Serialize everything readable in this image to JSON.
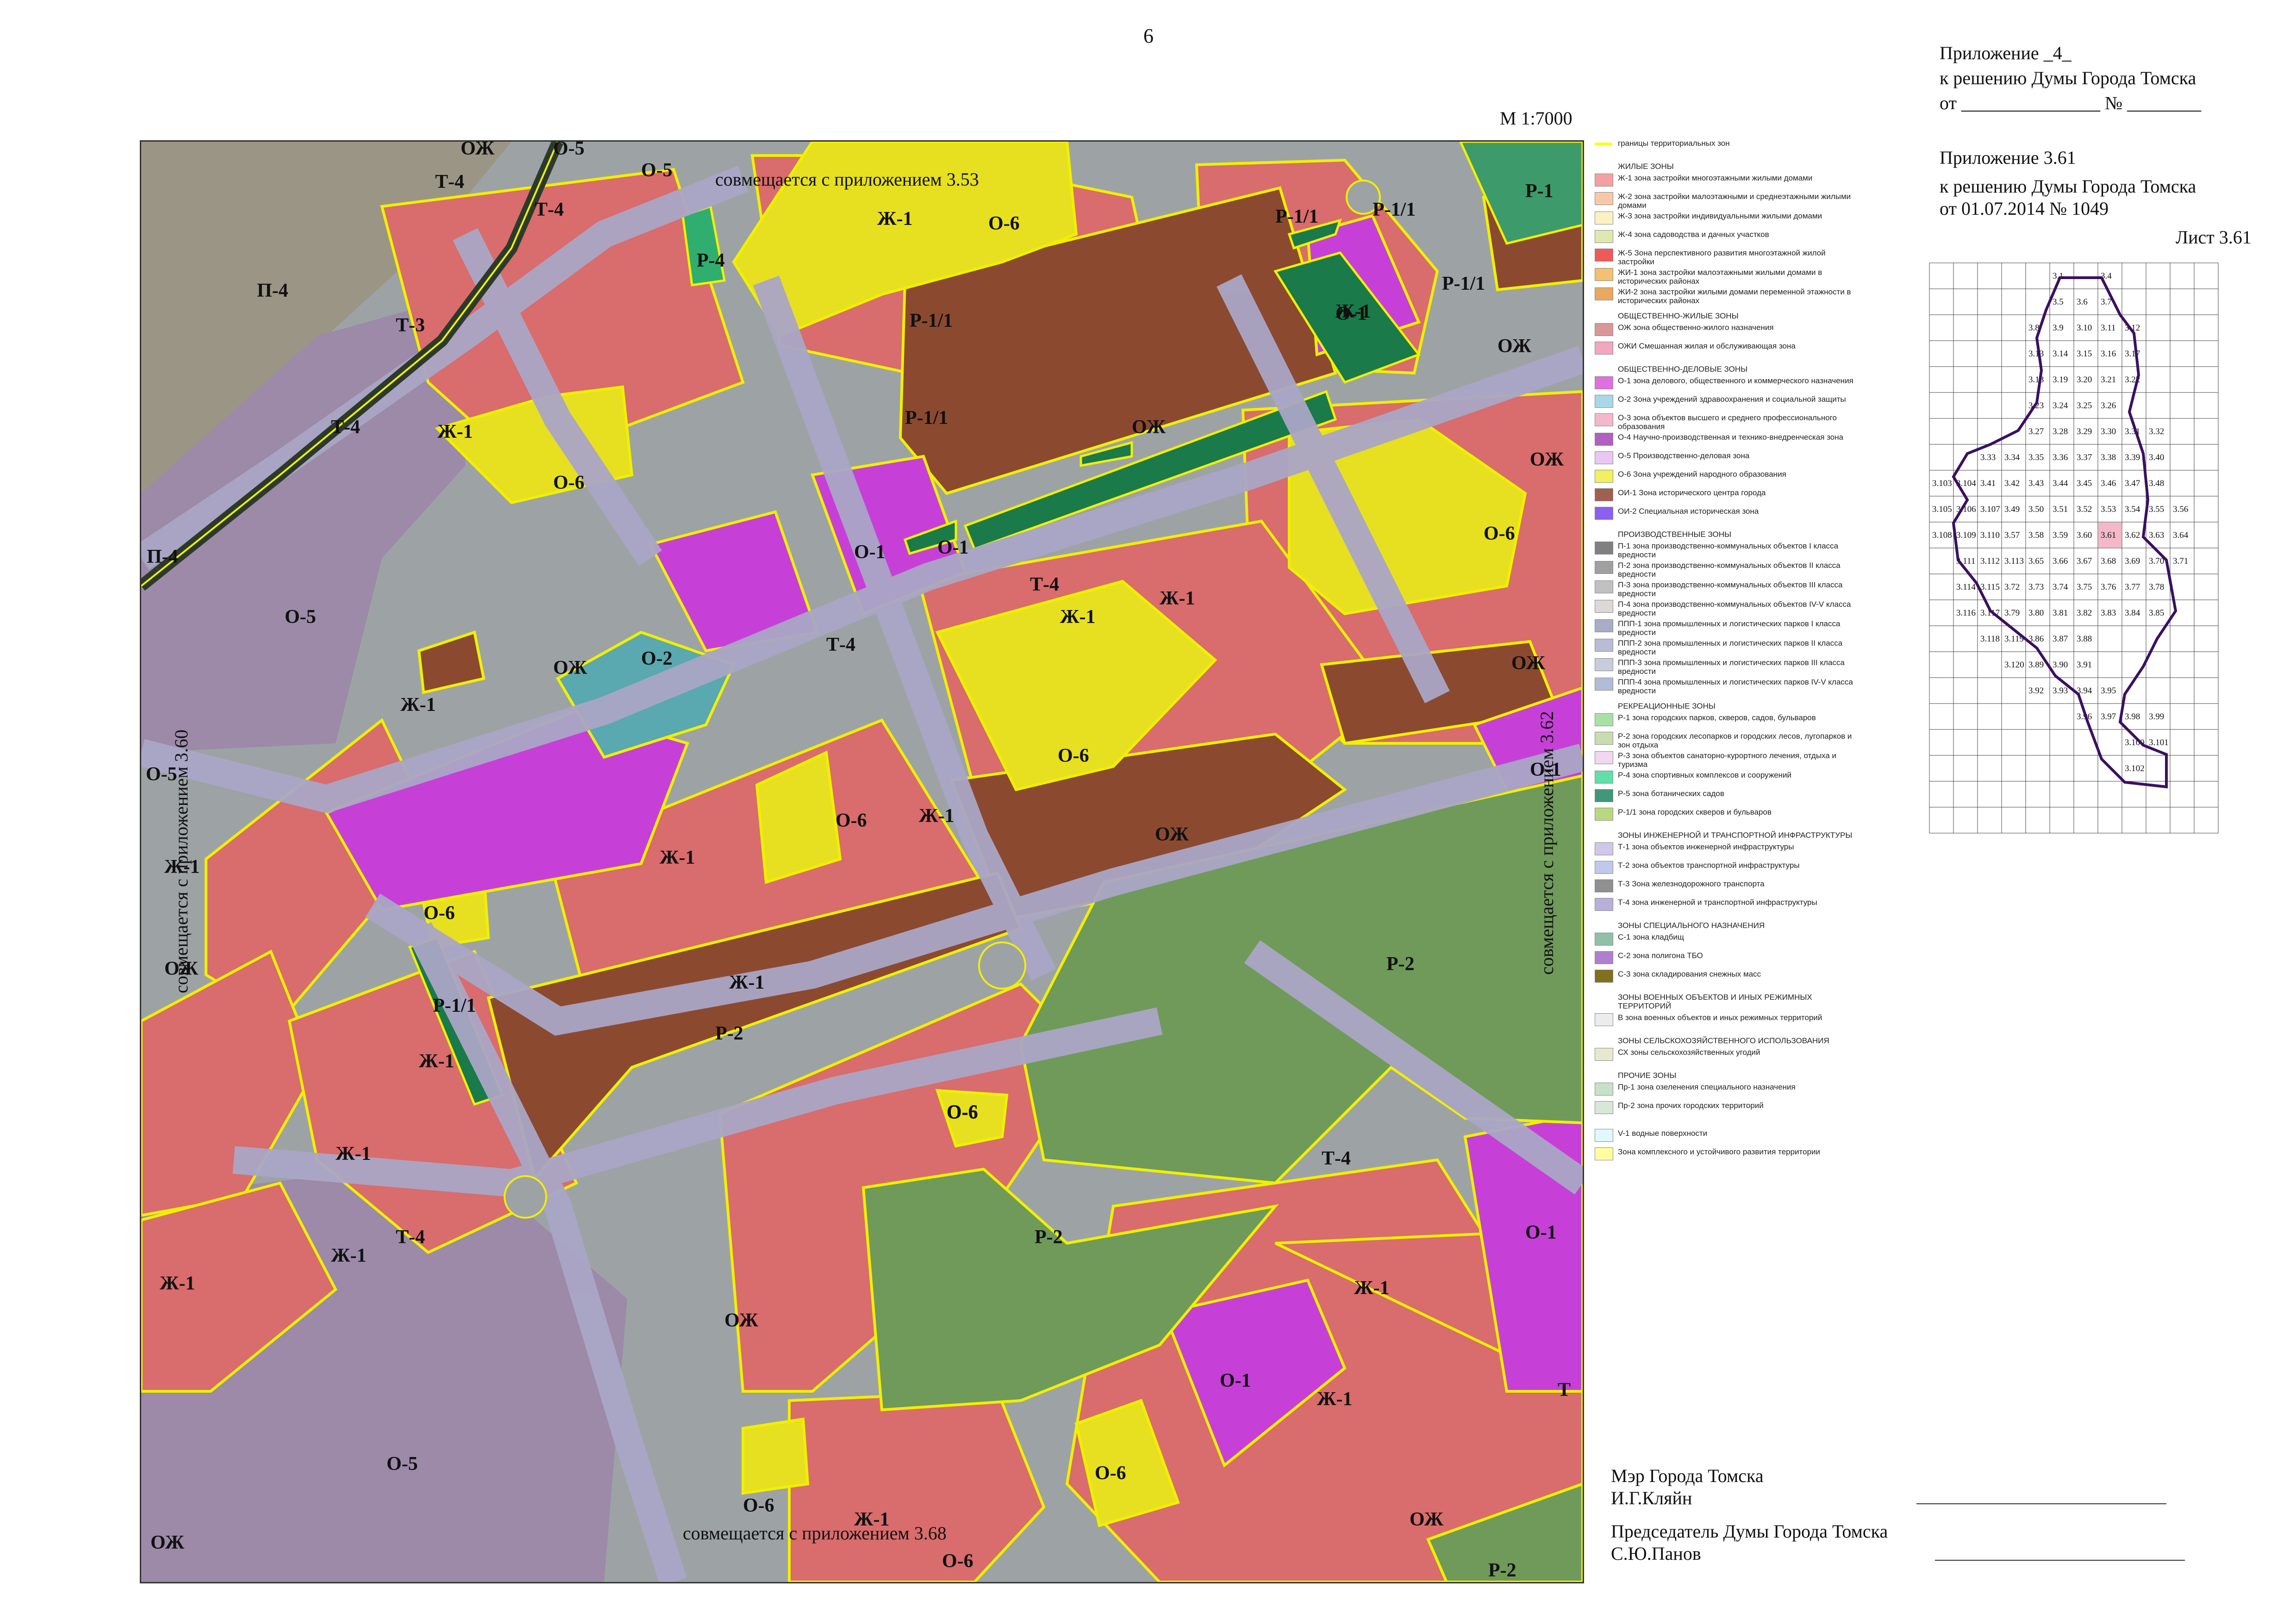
{
  "page_number": "6",
  "header": {
    "line1": "Приложение _4_",
    "line2": "к решению Думы Города Томска",
    "line3": "от _______________ № ________",
    "line4": "Приложение 3.61",
    "line5": "к решению Думы Города Томска",
    "line6": "от  01.07.2014  № 1049",
    "sheet": "Лист 3.61"
  },
  "scale": "М 1:7000",
  "edge_labels": {
    "top": "совмещается с приложением 3.53",
    "bottom": "совмещается с приложением 3.68",
    "left": "совмещается с приложением 3.60",
    "right": "совмещается с приложением 3.62"
  },
  "zone_labels": [
    "ОЖ",
    "О-5",
    "О-5",
    "Т-4",
    "Т-4",
    "Р-4",
    "Ж-1",
    "О-6",
    "Р-1/1",
    "Р-1/1",
    "Р-1",
    "П-4",
    "Т-3",
    "Ж-1",
    "Р-1/1",
    "Р-1/1",
    "О-1",
    "ОЖ",
    "Т-4",
    "Ж-1",
    "О-6",
    "Р-1/1",
    "ОЖ",
    "ОЖ",
    "Т-4",
    "П-4",
    "О-5",
    "О-1",
    "О-1",
    "Ж-1",
    "О-6",
    "О-2",
    "Т-4",
    "ОЖ",
    "Ж-1",
    "Ж-1",
    "О-6",
    "ОЖ",
    "ОЖ",
    "О-5",
    "О-6",
    "Ж-1",
    "О-6",
    "Ж-1",
    "Ж-1",
    "ОЖ",
    "Р-2",
    "О-1",
    "Ж-1",
    "О-6",
    "Р-1/1",
    "Ж-1",
    "ОЖ",
    "Ж-1",
    "Ж-1",
    "О-6",
    "Т-4",
    "Р-2",
    "О-1",
    "Ж-1",
    "Т-4",
    "Ж-1",
    "О-1",
    "Ж-1",
    "О-5",
    "О-6",
    "О-6",
    "Ж-1",
    "ОЖ",
    "ОЖ",
    "О-6",
    "Р-2",
    "Р-2",
    "Т"
  ],
  "legend": {
    "boundary": "границы территориальных зон",
    "sections": [
      {
        "title": "ЖИЛЫЕ ЗОНЫ",
        "items": [
          {
            "code": "Ж-1",
            "text": "Ж-1 зона застройки многоэтажными жилыми домами",
            "color": "#f4a0a0"
          },
          {
            "code": "Ж-2",
            "text": "Ж-2 зона застройки малоэтажными и среднеэтажными жилыми домами",
            "color": "#f7c8a8"
          },
          {
            "code": "Ж-3",
            "text": "Ж-3 зона застройки индивидуальными жилыми домами",
            "color": "#fbf2c4"
          },
          {
            "code": "Ж-4",
            "text": "Ж-4 зона садоводства и дачных участков",
            "color": "#dfe8b0"
          },
          {
            "code": "Ж-5",
            "text": "Ж-5 Зона перспективного развития многоэтажной жилой застройки",
            "color": "#ee5a5a"
          },
          {
            "code": "ЖИ-1",
            "text": "ЖИ-1 зона застройки малоэтажными жилыми домами в исторических районах",
            "color": "#f2c070"
          },
          {
            "code": "ЖИ-2",
            "text": "ЖИ-2 зона застройки жилыми домами переменной этажности в исторических районах",
            "color": "#e9a860"
          }
        ]
      },
      {
        "title": "ОБЩЕСТВЕННО-ЖИЛЫЕ ЗОНЫ",
        "items": [
          {
            "code": "ОЖ",
            "text": "ОЖ зона общественно-жилого назначения",
            "color": "#d89898"
          },
          {
            "code": "ОЖИ",
            "text": "ОЖИ Смешанная жилая и обслуживающая зона",
            "color": "#f2a6c0"
          }
        ]
      },
      {
        "title": "ОБЩЕСТВЕННО-ДЕЛОВЫЕ ЗОНЫ",
        "items": [
          {
            "code": "О-1",
            "text": "О-1 зона делового, общественного и коммерческого назначения",
            "color": "#e070e0"
          },
          {
            "code": "О-2",
            "text": "О-2 Зона учреждений здравоохранения и социальной защиты",
            "color": "#a8d8e8"
          },
          {
            "code": "О-3",
            "text": "О-3 зона объектов высшего и среднего профессионального образования",
            "color": "#f4b8c8"
          },
          {
            "code": "О-4",
            "text": "О-4 Научно-производственная и технико-внедренческая зона",
            "color": "#b060c0"
          },
          {
            "code": "О-5",
            "text": "О-5 Производственно-деловая зона",
            "color": "#e8c8f0"
          },
          {
            "code": "О-6",
            "text": "О-6 Зона учреждений народного образования",
            "color": "#f0f060"
          },
          {
            "code": "ОИ-1",
            "text": "ОИ-1 Зона исторического центра города",
            "color": "#a06050"
          },
          {
            "code": "ОИ-2",
            "text": "ОИ-2 Специальная историческая зона",
            "color": "#8a60f0"
          }
        ]
      },
      {
        "title": "ПРОИЗВОДСТВЕННЫЕ ЗОНЫ",
        "items": [
          {
            "code": "П-1",
            "text": "П-1 зона производственно-коммунальных объектов I класса вредности",
            "color": "#808080"
          },
          {
            "code": "П-2",
            "text": "П-2 зона производственно-коммунальных объектов II класса вредности",
            "color": "#a0a0a0"
          },
          {
            "code": "П-3",
            "text": "П-3 зона производственно-коммунальных объектов III класса вредности",
            "color": "#c0c0c0"
          },
          {
            "code": "П-4",
            "text": "П-4 зона производственно-коммунальных объектов IV-V класса вредности",
            "color": "#dcd8d8"
          },
          {
            "code": "ППП-1",
            "text": "ППП-1 зона промышленных и логистических парков I класса вредности",
            "color": "#a8acc8"
          },
          {
            "code": "ППП-2",
            "text": "ППП-2 зона промышленных и логистических парков II класса вредности",
            "color": "#b8bcd4"
          },
          {
            "code": "ППП-3",
            "text": "ППП-3 зона промышленных и логистических парков III класса вредности",
            "color": "#c8ccdc"
          },
          {
            "code": "ППП-4",
            "text": "ППП-4 зона промышленных и логистических парков IV-V класса вредности",
            "color": "#b0bcd8"
          }
        ]
      },
      {
        "title": "РЕКРЕАЦИОННЫЕ ЗОНЫ",
        "items": [
          {
            "code": "Р-1",
            "text": "Р-1 зона городских парков, скверов, садов, бульваров",
            "color": "#a8e0a8"
          },
          {
            "code": "Р-2",
            "text": "Р-2 зона городских лесопарков и городских лесов, лугопарков и зон отдыха",
            "color": "#c8dcb0"
          },
          {
            "code": "Р-3",
            "text": "Р-3 зона объектов санаторно-курортного лечения, отдыха и туризма",
            "color": "#f0d8f0"
          },
          {
            "code": "Р-4",
            "text": "Р-4 зона спортивных комплексов и сооружений",
            "color": "#60e0a8"
          },
          {
            "code": "Р-5",
            "text": "Р-5 зона ботанических садов",
            "color": "#409878"
          },
          {
            "code": "Р-1/1",
            "text": "Р-1/1 зона городских скверов и бульваров",
            "color": "#b8d880"
          }
        ]
      },
      {
        "title": "ЗОНЫ ИНЖЕНЕРНОЙ И ТРАНСПОРТНОЙ ИНФРАСТРУКТУРЫ",
        "items": [
          {
            "code": "Т-1",
            "text": "Т-1 зона объектов инженерной инфраструктуры",
            "color": "#d0c8e8"
          },
          {
            "code": "Т-2",
            "text": "Т-2 зона объектов транспортной инфраструктуры",
            "color": "#c0c8ec"
          },
          {
            "code": "Т-3",
            "text": "Т-3 Зона железнодорожного транспорта",
            "color": "#909090"
          },
          {
            "code": "Т-4",
            "text": "Т-4 зона инженерной и транспортной инфраструктуры",
            "color": "#b8b0d8"
          }
        ]
      },
      {
        "title": "ЗОНЫ СПЕЦИАЛЬНОГО НАЗНАЧЕНИЯ",
        "items": [
          {
            "code": "С-1",
            "text": "С-1 зона кладбищ",
            "color": "#90c0a8"
          },
          {
            "code": "С-2",
            "text": "С-2 зона полигона ТБО",
            "color": "#b080d0"
          },
          {
            "code": "С-3",
            "text": "С-3 зона складирования снежных масс",
            "color": "#807020"
          }
        ]
      },
      {
        "title": "ЗОНЫ ВОЕННЫХ ОБЪЕКТОВ И ИНЫХ РЕЖИМНЫХ ТЕРРИТОРИЙ",
        "items": [
          {
            "code": "В",
            "text": "В зона военных объектов и иных режимных территорий",
            "color": "#ececec"
          }
        ]
      },
      {
        "title": "ЗОНЫ СЕЛЬСКОХОЗЯЙСТВЕННОГО ИСПОЛЬЗОВАНИЯ",
        "items": [
          {
            "code": "СХ",
            "text": "СХ зоны сельскохозяйственных угодий",
            "color": "#e8e8d0"
          }
        ]
      },
      {
        "title": "ПРОЧИЕ ЗОНЫ",
        "items": [
          {
            "code": "Пр-1",
            "text": "Пр-1 зона озеленения специального назначения",
            "color": "#c8e0c8"
          },
          {
            "code": "Пр-2",
            "text": "Пр-2 зона прочих городских территорий",
            "color": "#d8e8d8"
          }
        ]
      },
      {
        "title": "",
        "items": [
          {
            "code": "V-1",
            "text": "V-1 водные поверхности",
            "color": "#e0f8ff"
          },
          {
            "code": "КУРТ",
            "text": "Зона комплексного и устойчивого развития территории",
            "color": "#ffffa0"
          }
        ]
      }
    ]
  },
  "index_grid": {
    "highlight": "3.61",
    "cells": [
      "3.1",
      "3.4",
      "3.5",
      "3.6",
      "3.7",
      "3.8",
      "3.9",
      "3.10",
      "3.11",
      "3.12",
      "3.13",
      "3.14",
      "3.15",
      "3.16",
      "3.17",
      "3.18",
      "3.19",
      "3.20",
      "3.21",
      "3.22",
      "3.23",
      "3.24",
      "3.25",
      "3.26",
      "3.27",
      "3.28",
      "3.29",
      "3.30",
      "3.31",
      "3.32",
      "3.33",
      "3.34",
      "3.35",
      "3.36",
      "3.37",
      "3.38",
      "3.39",
      "3.40",
      "3.103",
      "3.104",
      "3.41",
      "3.42",
      "3.43",
      "3.44",
      "3.45",
      "3.46",
      "3.47",
      "3.48",
      "3.105",
      "3.106",
      "3.107",
      "3.49",
      "3.50",
      "3.51",
      "3.52",
      "3.53",
      "3.54",
      "3.55",
      "3.56",
      "3.108",
      "3.109",
      "3.110",
      "3.57",
      "3.58",
      "3.59",
      "3.60",
      "3.61",
      "3.62",
      "3.63",
      "3.64",
      "3.111",
      "3.112",
      "3.113",
      "3.65",
      "3.66",
      "3.67",
      "3.68",
      "3.69",
      "3.70",
      "3.71",
      "3.114",
      "3.115",
      "3.72",
      "3.73",
      "3.74",
      "3.75",
      "3.76",
      "3.77",
      "3.78",
      "3.116",
      "3.117",
      "3.79",
      "3.80",
      "3.81",
      "3.82",
      "3.83",
      "3.84",
      "3.85",
      "3.118",
      "3.119",
      "3.86",
      "3.87",
      "3.88",
      "3.120",
      "3.89",
      "3.90",
      "3.91",
      "3.92",
      "3.93",
      "3.94",
      "3.95",
      "3.96",
      "3.97",
      "3.98",
      "3.99",
      "3.100",
      "3.101",
      "3.102"
    ]
  },
  "signatures": {
    "mayor_title": "Мэр Города Томска",
    "mayor_name": "И.Г.Кляйн",
    "chair_title": "Председатель Думы Города Томска",
    "chair_name": "С.Ю.Панов"
  },
  "colors": {
    "residential": "#d96c6c",
    "public_residential": "#8b4a30",
    "education": "#e6e020",
    "business": "#c640d8",
    "health": "#5aa8b0",
    "park_green": "#1a7a4a",
    "forest": "#6f9a5a",
    "transport": "#a8a4c8",
    "production": "#9a8aa8",
    "boundary": "#f0f000"
  }
}
